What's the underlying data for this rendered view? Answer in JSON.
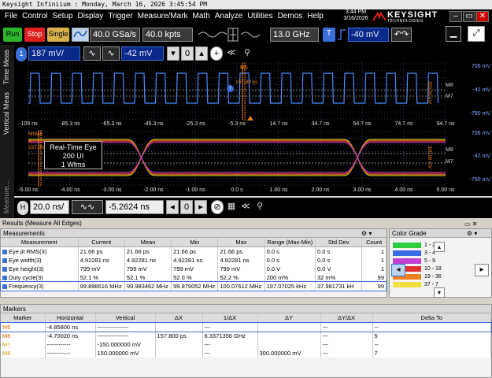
{
  "window": {
    "title": "Keysight Infiniium : Monday, March 16, 2026 3:45:54 PM"
  },
  "menu": [
    "File",
    "Control",
    "Setup",
    "Display",
    "Trigger",
    "Measure/Mark",
    "Math",
    "Analyze",
    "Utilities",
    "Demos",
    "Help"
  ],
  "clock": {
    "time": "3:44 PM",
    "date": "3/16/2026"
  },
  "brand": {
    "name": "KEYSIGHT",
    "sub": "TECHNOLOGIES"
  },
  "toolbar": {
    "run": "Run",
    "stop": "Stop",
    "single": "Single",
    "sample_rate": "40.0 GSa/s",
    "memory": "40.0 kpts",
    "bandwidth": "13.0 GHz",
    "trigger_source": "T",
    "trigger_level": "-40 mV",
    "colors": {
      "run": "#2db52d",
      "stop": "#e02020",
      "single": "#d8b04a"
    }
  },
  "channel": {
    "scale": "187 mV/",
    "offset": "-42 mV"
  },
  "sidebar": {
    "tabs": [
      "Time Meas",
      "Vertical Meas",
      "Measure..."
    ]
  },
  "upper_grid": {
    "time_labels": [
      "-105 ns",
      "-85.3 ns",
      "-65.3 ns",
      "-45.3 ns",
      "-25.3 ns",
      "-5.3 ns",
      "14.7 ns",
      "34.7 ns",
      "54.7 ns",
      "74.7 ns",
      "94.7 ns"
    ],
    "right_labels": [
      "706 mV",
      "-42 mV",
      "-790 mV"
    ],
    "marker_readout": {
      "name": "M5",
      "dx": "157.80 ps"
    },
    "markers": [
      "M8",
      "M7"
    ],
    "vertical_span": "300.00 mV"
  },
  "lower_grid": {
    "time_labels": [
      "-5.00 ns",
      "-4.00 ns",
      "-3.00 ns",
      "-2.00 ns",
      "-1.00 ns",
      "0.0 s",
      "1.00 ns",
      "2.00 ns",
      "3.00 ns",
      "4.00 ns",
      "5.00 ns"
    ],
    "right_labels": [
      "706 mV",
      "-42 mV",
      "-790 mV"
    ],
    "eye_info": [
      "Real-Time Eye",
      "200 UI",
      "1 Wfms"
    ],
    "left_markers": {
      "top": "M5M6",
      "k": "K",
      "value": "157.80"
    },
    "markers": [
      "M8",
      "M7"
    ],
    "vertical_span": "300.00 mV"
  },
  "timebase": {
    "scale": "20.0 ns/",
    "delay": "-5.2624 ns"
  },
  "results": {
    "title": "Results   (Measure All Edges)",
    "section": "Measurements",
    "columns": [
      "Measurement",
      "Current",
      "Mean",
      "Min",
      "Max",
      "Range (Max-Min)",
      "Std Dev",
      "Count"
    ],
    "rows": [
      {
        "name": "Eye jit RMS(3)",
        "current": "21.66 ps",
        "mean": "21.66 ps",
        "min": "21.66 ps",
        "max": "21.66 ps",
        "range": "0.0 s",
        "std": "0.0 s",
        "count": "1"
      },
      {
        "name": "Eye width(3)",
        "current": "4.92281 ns",
        "mean": "4.92281 ns",
        "min": "4.92281 ns",
        "max": "4.92281 ns",
        "range": "0.0 s",
        "std": "0.0 s",
        "count": "1"
      },
      {
        "name": "Eye height(3)",
        "current": "799 mV",
        "mean": "799 mV",
        "min": "799 mV",
        "max": "799 mV",
        "range": "0.0 V",
        "std": "0.0 V",
        "count": "1"
      },
      {
        "name": "Duty cycle(3)",
        "current": "52.1 %",
        "mean": "52.1 %",
        "min": "52.0 %",
        "max": "52.2 %",
        "range": "200 m%",
        "std": "32 m%",
        "count": "99"
      },
      {
        "name": "Frequency(3)",
        "current": "99.898616 MHz",
        "mean": "99.983462 MHz",
        "min": "99.879052 MHz",
        "max": "100.07612 MHz",
        "range": "197.07025 kHz",
        "std": "37.981731 kH",
        "count": "99"
      }
    ]
  },
  "color_grade": {
    "title": "Color Grade",
    "rows": [
      {
        "label": "1 - 2",
        "color": "#2ecc40"
      },
      {
        "label": "3 - 4",
        "color": "#3a6ee8"
      },
      {
        "label": "5 - 9",
        "color": "#c040d0"
      },
      {
        "label": "10 - 18",
        "color": "#e03030"
      },
      {
        "label": "19 - 36",
        "color": "#f08020"
      },
      {
        "label": "37 - 7",
        "color": "#f0e040"
      }
    ]
  },
  "markers_panel": {
    "title": "Markers",
    "columns": [
      "Marker",
      "Horizontal",
      "Vertical",
      "ΔX",
      "1/ΔX",
      "ΔY",
      "ΔY/ΔX",
      "Delta To"
    ],
    "rows": [
      {
        "marker": "M5",
        "h": "-4.85800 ns",
        "v": "----------------",
        "dx": "",
        "idx": "---",
        "dy": "",
        "dydx": "---",
        "to": "--",
        "color": "#d46a00"
      },
      {
        "marker": "M6",
        "h": "-4.70020 ns",
        "v": "----------------",
        "dx": "157.800 ps",
        "idx": "6.3371356 GHz",
        "dy": "",
        "dydx": "---",
        "to": "5",
        "color": "#d46a00"
      },
      {
        "marker": "M7",
        "h": "------------",
        "v": "-150.000000 mV",
        "dx": "",
        "idx": "---",
        "dy": "",
        "dydx": "---",
        "to": "--",
        "color": "#c8a000"
      },
      {
        "marker": "M8",
        "h": "------------",
        "v": "150.000000 mV",
        "dx": "",
        "idx": "---",
        "dy": "300.000000 mV",
        "dydx": "---",
        "to": "7",
        "color": "#c8a000"
      }
    ]
  }
}
